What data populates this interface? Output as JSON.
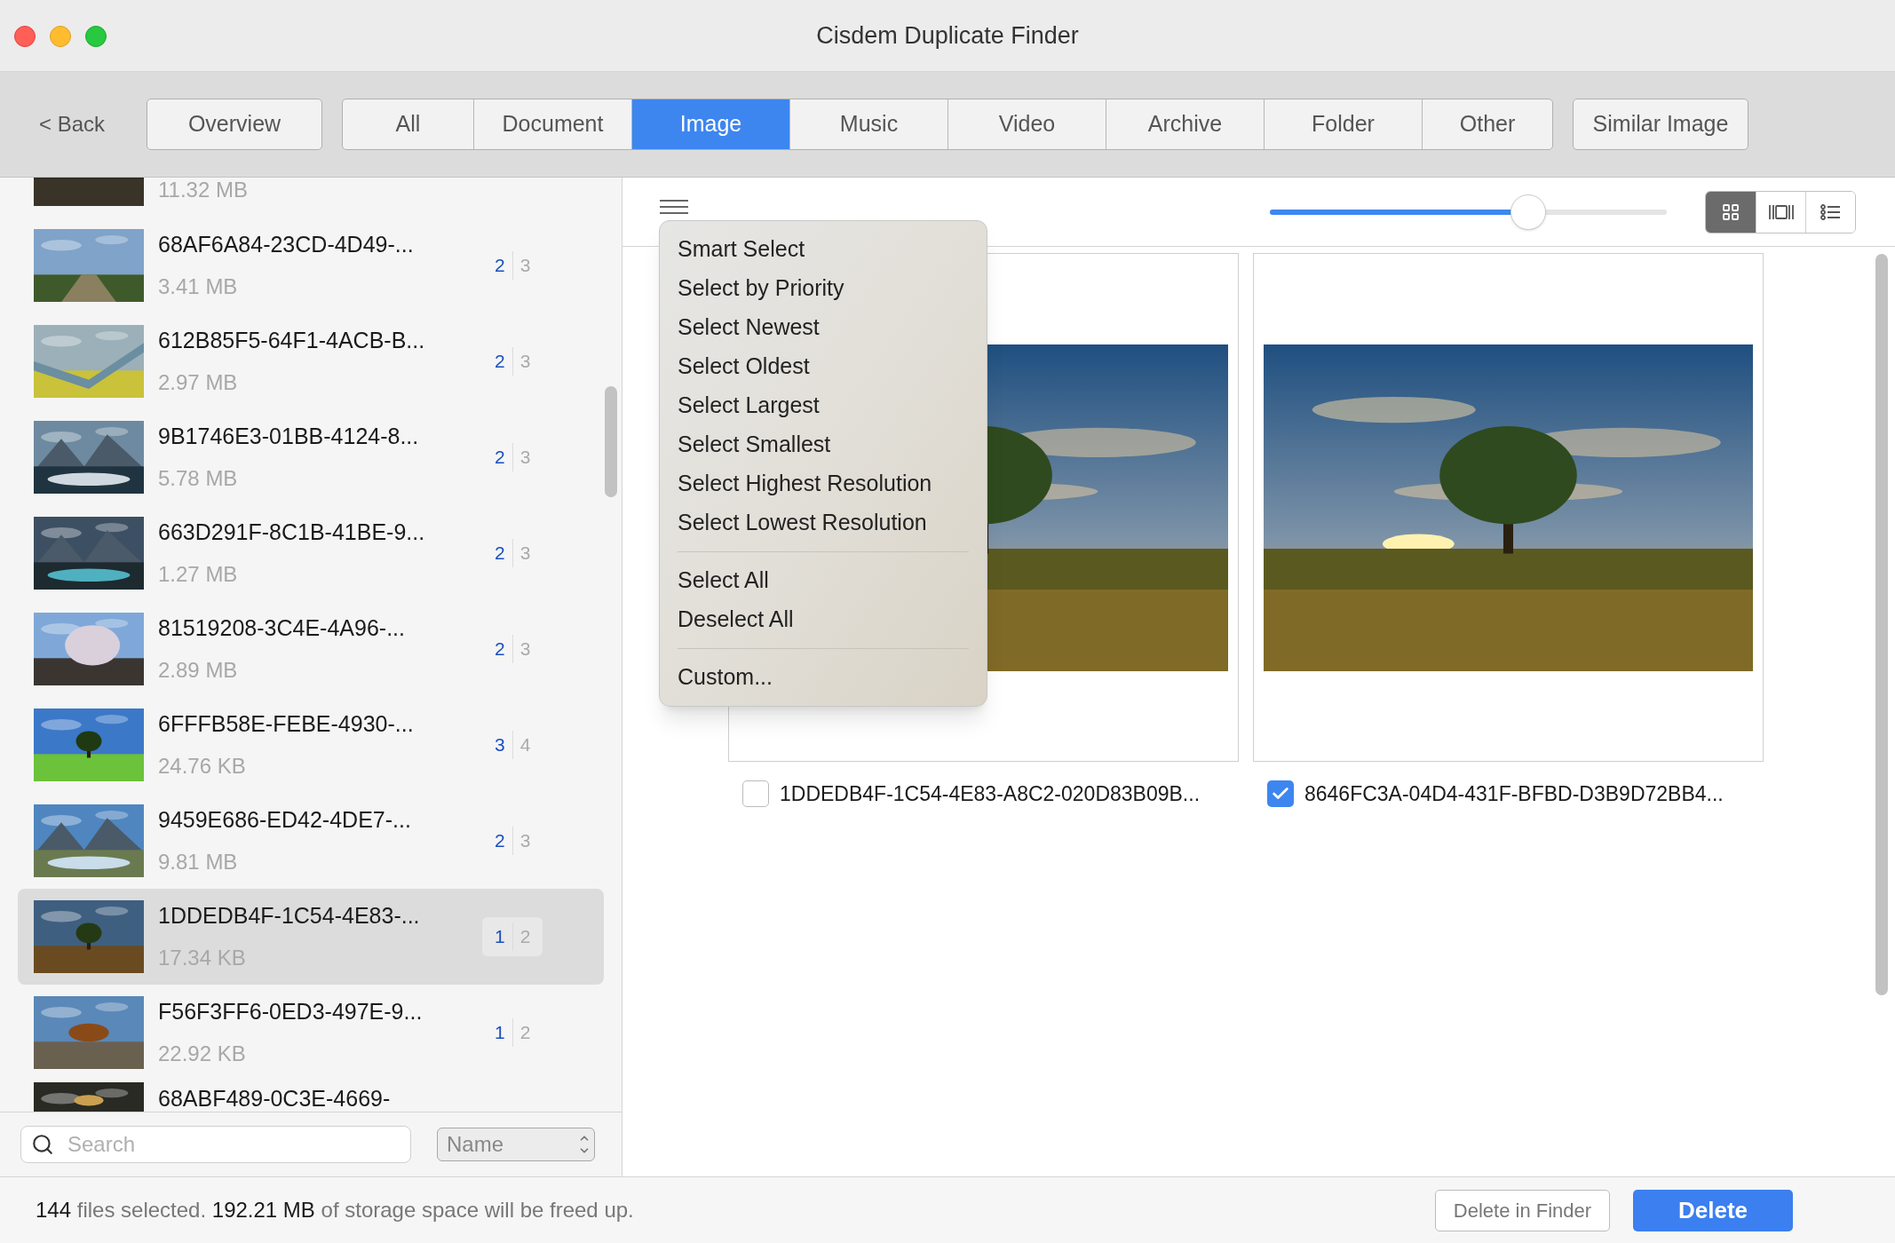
{
  "window": {
    "title": "Cisdem Duplicate Finder"
  },
  "toolbar": {
    "back": "< Back",
    "overview": "Overview",
    "similar_image": "Similar Image",
    "tabs": [
      {
        "label": "All",
        "selected": false
      },
      {
        "label": "Document",
        "selected": false
      },
      {
        "label": "Image",
        "selected": true
      },
      {
        "label": "Music",
        "selected": false
      },
      {
        "label": "Video",
        "selected": false
      },
      {
        "label": "Archive",
        "selected": false
      },
      {
        "label": "Folder",
        "selected": false
      },
      {
        "label": "Other",
        "selected": false
      }
    ]
  },
  "file_list": {
    "partial_top_size": "11.32 MB",
    "partial_bottom_name": "68ABF489-0C3E-4669-",
    "rows": [
      {
        "name": "68AF6A84-23CD-4D49-...",
        "size": "3.41 MB",
        "selected_count": "2",
        "total_count": "3",
        "selected": false
      },
      {
        "name": "612B85F5-64F1-4ACB-B...",
        "size": "2.97 MB",
        "selected_count": "2",
        "total_count": "3",
        "selected": false
      },
      {
        "name": "9B1746E3-01BB-4124-8...",
        "size": "5.78 MB",
        "selected_count": "2",
        "total_count": "3",
        "selected": false
      },
      {
        "name": "663D291F-8C1B-41BE-9...",
        "size": "1.27 MB",
        "selected_count": "2",
        "total_count": "3",
        "selected": false
      },
      {
        "name": "81519208-3C4E-4A96-...",
        "size": "2.89 MB",
        "selected_count": "2",
        "total_count": "3",
        "selected": false
      },
      {
        "name": "6FFFB58E-FEBE-4930-...",
        "size": "24.76 KB",
        "selected_count": "3",
        "total_count": "4",
        "selected": false
      },
      {
        "name": "9459E686-ED42-4DE7-...",
        "size": "9.81 MB",
        "selected_count": "2",
        "total_count": "3",
        "selected": false
      },
      {
        "name": "1DDEDB4F-1C54-4E83-...",
        "size": "17.34 KB",
        "selected_count": "1",
        "total_count": "2",
        "selected": true
      },
      {
        "name": "F56F3FF6-0ED3-497E-9...",
        "size": "22.92 KB",
        "selected_count": "1",
        "total_count": "2",
        "selected": false
      }
    ],
    "search": {
      "placeholder": "Search"
    },
    "sort": "Name"
  },
  "preview": {
    "slider": {
      "level": 0.65
    },
    "view_modes": [
      {
        "kind": "grid",
        "selected": true
      },
      {
        "kind": "filmstrip",
        "selected": false
      },
      {
        "kind": "list",
        "selected": false
      }
    ],
    "menu": {
      "groups": [
        [
          "Smart Select",
          "Select by Priority",
          "Select Newest",
          "Select Oldest",
          "Select Largest",
          "Select Smallest",
          "Select Highest Resolution",
          "Select Lowest Resolution"
        ],
        [
          "Select All",
          "Deselect All"
        ],
        [
          "Custom..."
        ]
      ]
    },
    "cards": [
      {
        "name": "1DDEDB4F-1C54-4E83-A8C2-020D83B09B...",
        "checked": false
      },
      {
        "name": "8646FC3A-04D4-431F-BFBD-D3B9D72BB4...",
        "checked": true
      }
    ]
  },
  "status": {
    "text": "**144** files selected. **192.21 MB** of storage space will be freed up.",
    "delete_in_finder": "Delete in Finder",
    "delete": "Delete"
  }
}
